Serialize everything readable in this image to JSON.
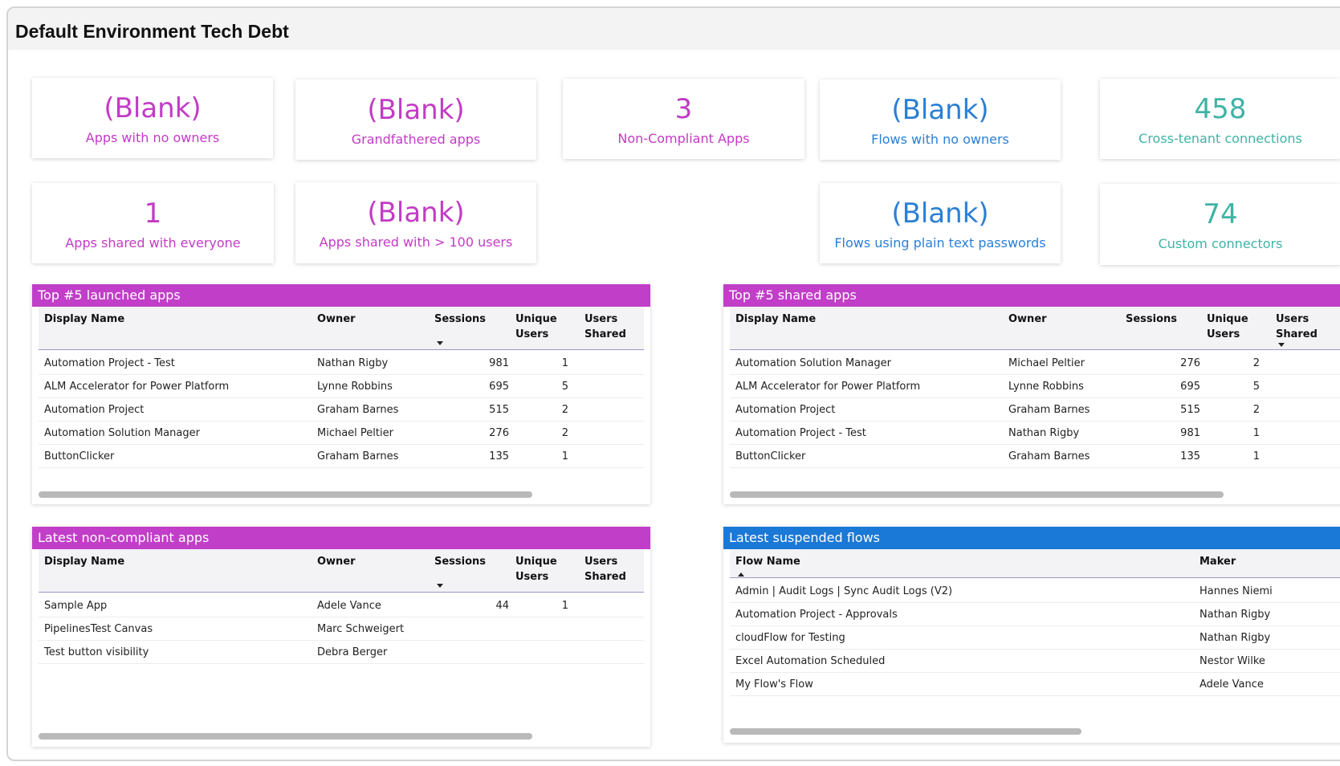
{
  "page_title": "Default Environment Tech Debt",
  "colors": {
    "magenta": "#c23bc5",
    "blue": "#2b7fd4",
    "teal": "#3fb3a5",
    "header_magenta": "#c13ec8",
    "header_blue": "#1a78d6"
  },
  "cards": {
    "apps_no_owners": {
      "value": "(Blank)",
      "label": "Apps with no owners"
    },
    "grandfathered_apps": {
      "value": "(Blank)",
      "label": "Grandfathered apps"
    },
    "non_compliant_apps": {
      "value": "3",
      "label": "Non-Compliant Apps"
    },
    "flows_no_owners": {
      "value": "(Blank)",
      "label": "Flows with no owners"
    },
    "cross_tenant": {
      "value": "458",
      "label": "Cross-tenant connections"
    },
    "shared_everyone": {
      "value": "1",
      "label": "Apps shared with everyone"
    },
    "shared_100": {
      "value": "(Blank)",
      "label": "Apps shared with > 100 users"
    },
    "plain_text_passwords": {
      "value": "(Blank)",
      "label": "Flows using plain text passwords"
    },
    "custom_connectors": {
      "value": "74",
      "label": "Custom connectors"
    }
  },
  "app_columns": {
    "display_name": "Display Name",
    "owner": "Owner",
    "sessions": "Sessions",
    "unique_users_1": "Unique",
    "unique_users_2": "Users",
    "users_shared_1": "Users",
    "users_shared_2": "Shared"
  },
  "top_launched": {
    "title": "Top #5 launched apps",
    "rows": [
      {
        "name": "Automation Project - Test",
        "owner": "Nathan Rigby",
        "sessions": "981",
        "unique": "1"
      },
      {
        "name": "ALM Accelerator for Power Platform",
        "owner": "Lynne Robbins",
        "sessions": "695",
        "unique": "5"
      },
      {
        "name": "Automation Project",
        "owner": "Graham Barnes",
        "sessions": "515",
        "unique": "2"
      },
      {
        "name": "Automation Solution Manager",
        "owner": "Michael Peltier",
        "sessions": "276",
        "unique": "2"
      },
      {
        "name": "ButtonClicker",
        "owner": "Graham Barnes",
        "sessions": "135",
        "unique": "1"
      }
    ]
  },
  "top_shared": {
    "title": "Top #5 shared apps",
    "rows": [
      {
        "name": "Automation Solution Manager",
        "owner": "Michael Peltier",
        "sessions": "276",
        "unique": "2"
      },
      {
        "name": "ALM Accelerator for Power Platform",
        "owner": "Lynne Robbins",
        "sessions": "695",
        "unique": "5"
      },
      {
        "name": "Automation Project",
        "owner": "Graham Barnes",
        "sessions": "515",
        "unique": "2"
      },
      {
        "name": "Automation Project - Test",
        "owner": "Nathan Rigby",
        "sessions": "981",
        "unique": "1"
      },
      {
        "name": "ButtonClicker",
        "owner": "Graham Barnes",
        "sessions": "135",
        "unique": "1"
      }
    ]
  },
  "non_compliant": {
    "title": "Latest non-compliant apps",
    "rows": [
      {
        "name": "Sample App",
        "owner": "Adele Vance",
        "sessions": "44",
        "unique": "1"
      },
      {
        "name": "PipelinesTest Canvas",
        "owner": "Marc Schweigert",
        "sessions": "",
        "unique": ""
      },
      {
        "name": "Test button visibility",
        "owner": "Debra Berger",
        "sessions": "",
        "unique": ""
      }
    ]
  },
  "suspended_flows": {
    "title": "Latest suspended flows",
    "columns": {
      "flow_name": "Flow Name",
      "maker": "Maker"
    },
    "rows": [
      {
        "name": "Admin | Audit Logs | Sync Audit Logs (V2)",
        "maker": "Hannes Niemi"
      },
      {
        "name": "Automation Project - Approvals",
        "maker": "Nathan Rigby"
      },
      {
        "name": "cloudFlow for Testing",
        "maker": "Nathan Rigby"
      },
      {
        "name": "Excel Automation Scheduled",
        "maker": "Nestor Wilke"
      },
      {
        "name": "My Flow's Flow",
        "maker": "Adele Vance"
      }
    ]
  }
}
